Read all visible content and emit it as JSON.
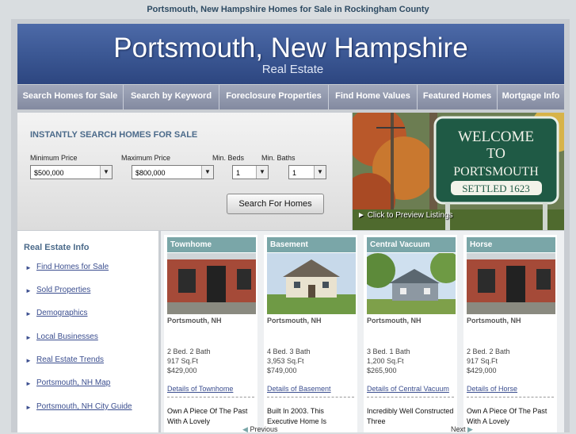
{
  "page_title": "Portsmouth, New Hampshire Homes for Sale in Rockingham County",
  "header": {
    "title": "Portsmouth, New Hampshire",
    "subtitle": "Real Estate"
  },
  "nav": [
    "Search Homes for Sale",
    "Search by Keyword",
    "Foreclosure Properties",
    "Find Home Values",
    "Featured Homes",
    "Mortgage Info"
  ],
  "search": {
    "heading": "INSTANTLY SEARCH HOMES FOR SALE",
    "min_price_label": "Minimum Price",
    "min_price": "$500,000",
    "max_price_label": "Maximum Price",
    "max_price": "$800,000",
    "beds_label": "Min. Beds",
    "beds": "1",
    "baths_label": "Min. Baths",
    "baths": "1",
    "button": "Search For Homes"
  },
  "photo": {
    "sign_lines": [
      "WELCOME",
      "TO",
      "PORTSMOUTH",
      "SETTLED 1623"
    ],
    "caption": "Click to Preview Listings"
  },
  "sidebar": {
    "heading": "Real Estate Info",
    "items": [
      "Find Homes for Sale",
      "Sold Properties",
      "Demographics",
      "Local Businesses",
      "Real Estate Trends",
      "Portsmouth, NH Map",
      "Portsmouth, NH City Guide"
    ]
  },
  "listings": [
    {
      "tag": "Townhome",
      "city": "Portsmouth, NH",
      "beds_baths": "2 Bed. 2 Bath",
      "sqft": "917 Sq.Ft",
      "price": "$429,000",
      "details": "Details of Townhome",
      "desc": "Own A Piece Of The Past With A Lovely"
    },
    {
      "tag": "Basement",
      "city": "Portsmouth, NH",
      "beds_baths": "4 Bed. 3 Bath",
      "sqft": "3,953 Sq.Ft",
      "price": "$749,000",
      "details": "Details of Basement",
      "desc": "Built In 2003. This Executive Home Is"
    },
    {
      "tag": "Central Vacuum",
      "city": "Portsmouth, NH",
      "beds_baths": "3 Bed. 1 Bath",
      "sqft": "1,200 Sq.Ft",
      "price": "$265,900",
      "details": "Details of Central Vacuum",
      "desc": "Incredibly Well Constructed Three"
    },
    {
      "tag": "Horse",
      "city": "Portsmouth, NH",
      "beds_baths": "2 Bed. 2 Bath",
      "sqft": "917 Sq.Ft",
      "price": "$429,000",
      "details": "Details of Horse",
      "desc": "Own A Piece Of The Past With A Lovely"
    }
  ],
  "pager": {
    "prev": "Previous",
    "next": "Next"
  },
  "colors": {
    "header": "#3a5692",
    "nav": "#8c93a8",
    "tag": "#7aa6a8",
    "link": "#3b4e8f"
  }
}
